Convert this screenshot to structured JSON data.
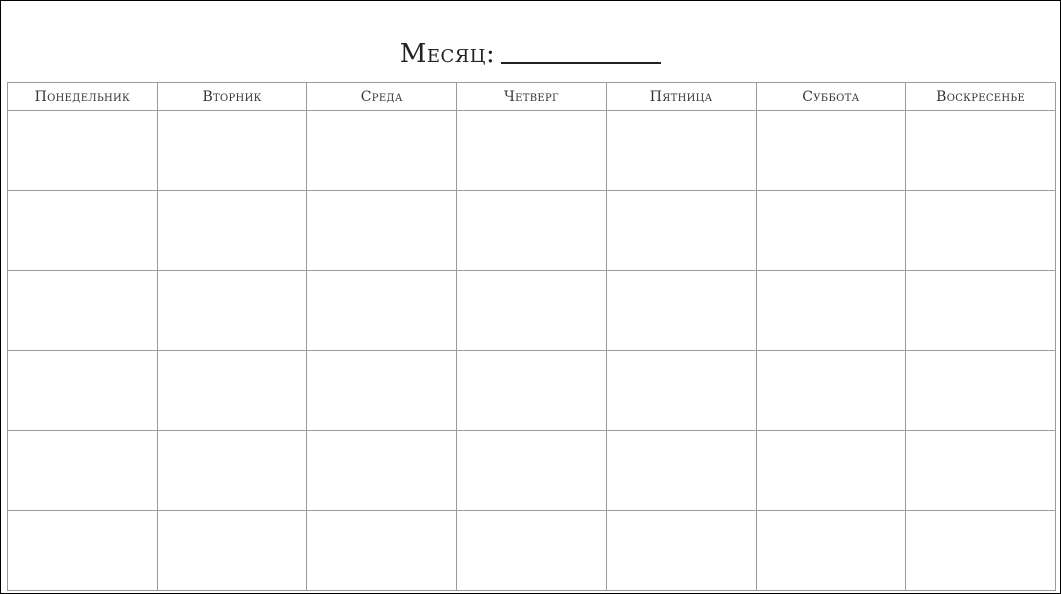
{
  "header": {
    "title_label": "Месяц:"
  },
  "calendar": {
    "weekdays": [
      "Понедельник",
      "Вторник",
      "Среда",
      "Четверг",
      "Пятница",
      "Суббота",
      "Воскресенье"
    ],
    "week_rows": 6,
    "grid_color": "#9a9a9a",
    "frame_color": "#000000"
  }
}
